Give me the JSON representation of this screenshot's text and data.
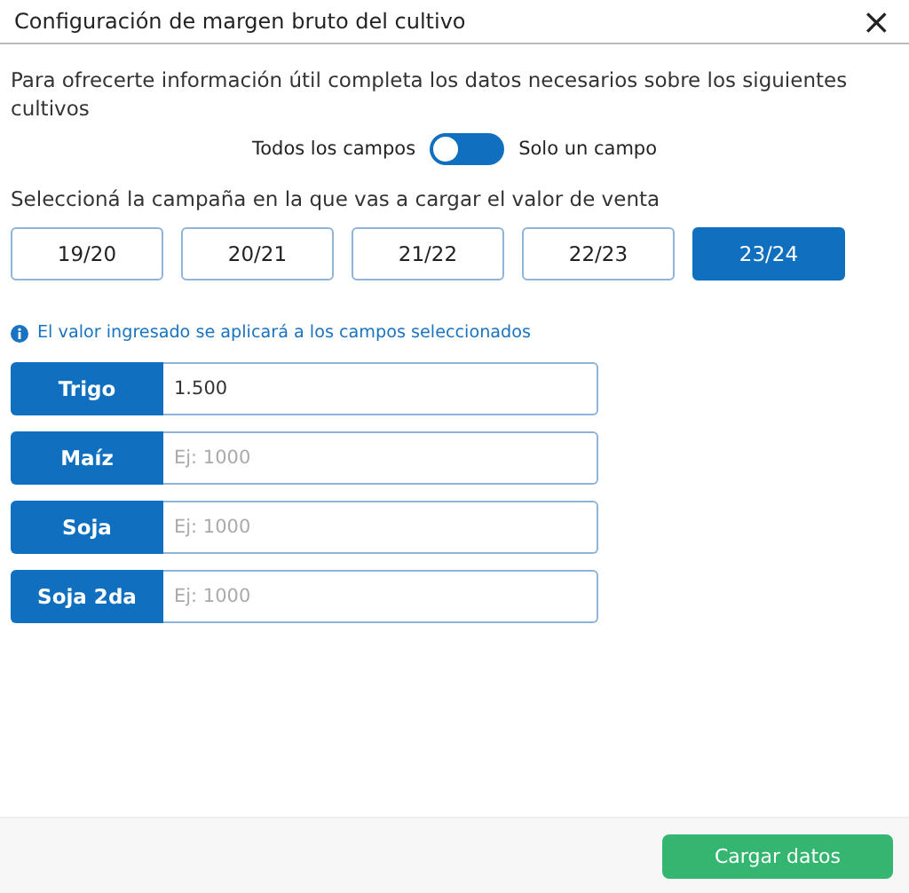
{
  "dialog": {
    "title": "Configuración de margen bruto del cultivo",
    "close": "×"
  },
  "intro": "Para ofrecerte información útil completa los datos necesarios sobre los siguientes cultivos",
  "toggle": {
    "left_label": "Todos los campos",
    "right_label": "Solo un campo",
    "on": false
  },
  "campaign_prompt": "Seleccioná la campaña en la que vas a cargar el valor de venta",
  "campaigns": [
    {
      "label": "19/20",
      "selected": false
    },
    {
      "label": "20/21",
      "selected": false
    },
    {
      "label": "21/22",
      "selected": false
    },
    {
      "label": "22/23",
      "selected": false
    },
    {
      "label": "23/24",
      "selected": true
    }
  ],
  "info": "El valor ingresado se aplicará a los campos seleccionados",
  "crops": [
    {
      "name": "Trigo",
      "value": "1.500"
    },
    {
      "name": "Maíz",
      "placeholder": "Ej: 1000"
    },
    {
      "name": "Soja",
      "placeholder": "Ej: 1000"
    },
    {
      "name": "Soja 2da",
      "placeholder": "Ej: 1000"
    }
  ],
  "footer": {
    "button": "Cargar datos"
  }
}
